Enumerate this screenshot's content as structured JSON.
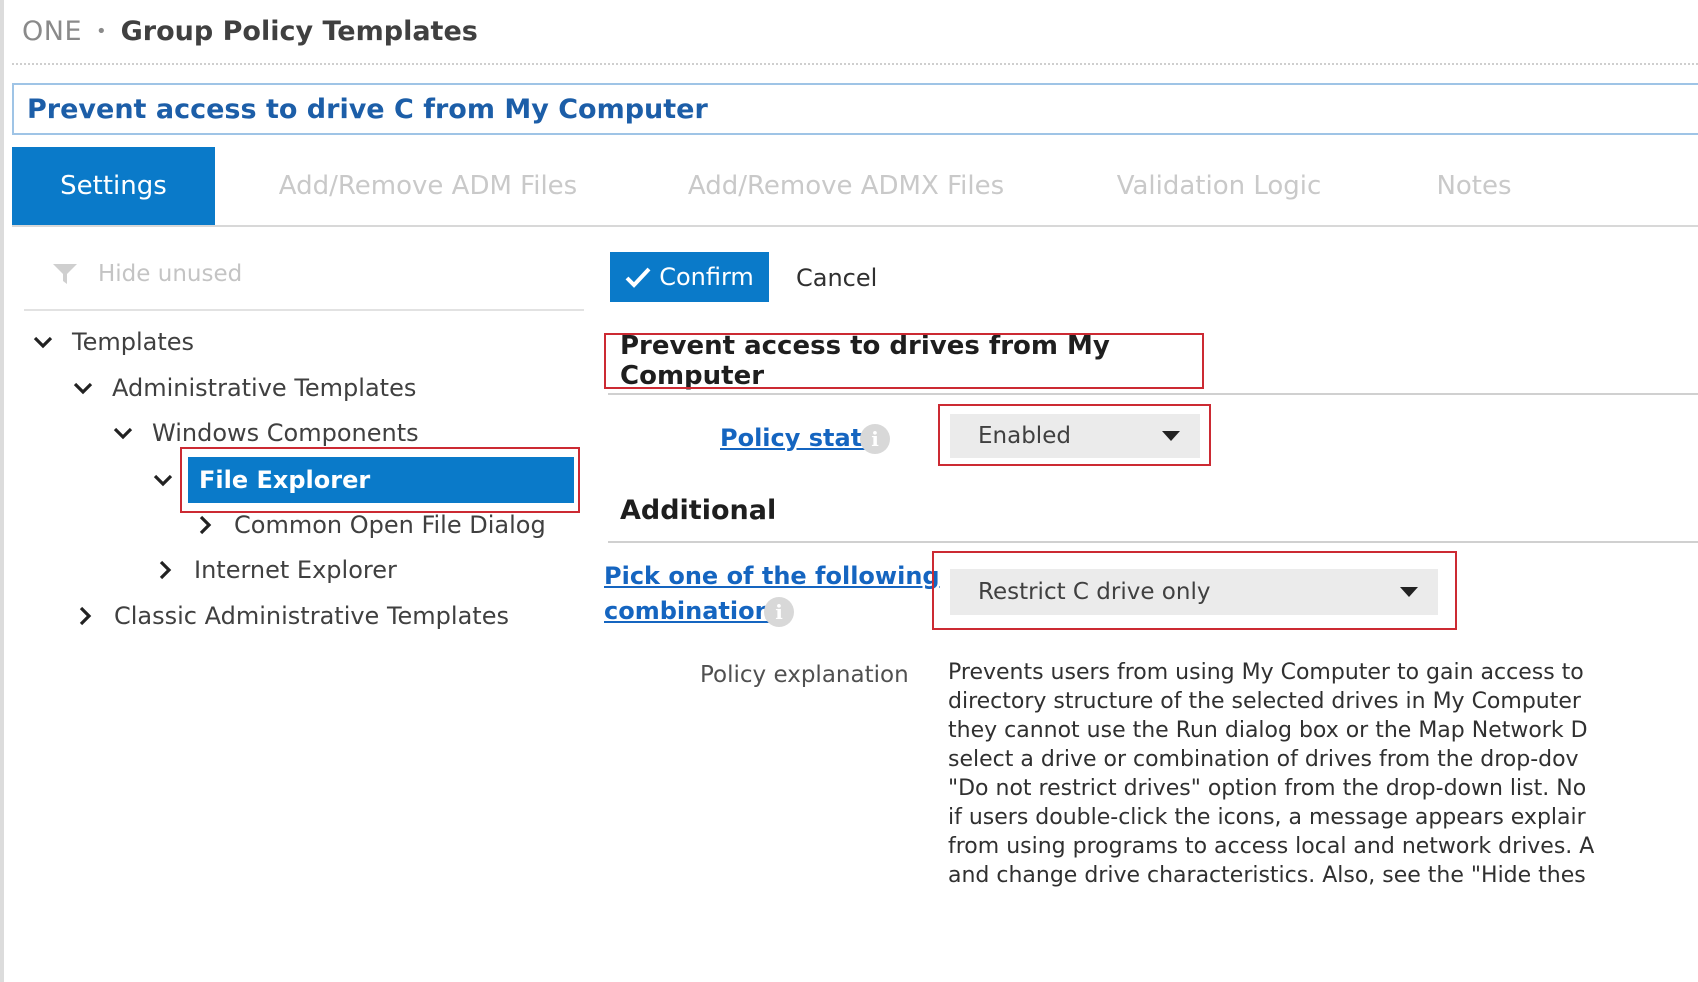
{
  "breadcrumb": {
    "root": "ONE",
    "separator": "•",
    "current": "Group Policy Templates"
  },
  "title": "Prevent access to drive C from My Computer",
  "tabs": [
    {
      "label": "Settings",
      "active": true
    },
    {
      "label": "Add/Remove ADM Files",
      "active": false
    },
    {
      "label": "Add/Remove ADMX Files",
      "active": false
    },
    {
      "label": "Validation Logic",
      "active": false
    },
    {
      "label": "Notes",
      "active": false
    }
  ],
  "filter": {
    "label": "Hide unused",
    "icon": "filter-icon"
  },
  "tree": {
    "templates": "Templates",
    "administrative_templates": "Administrative Templates",
    "windows_components": "Windows Components",
    "file_explorer": "File Explorer",
    "common_open_file_dialog": "Common Open File Dialog",
    "internet_explorer": "Internet Explorer",
    "classic_administrative_templates": "Classic Administrative Templates"
  },
  "actions": {
    "confirm": "Confirm",
    "cancel": "Cancel"
  },
  "policy": {
    "title": "Prevent access to drives from My Computer",
    "state_label": "Policy state",
    "state_value": "Enabled",
    "additional_heading": "Additional",
    "combination_label_line1": "Pick one of the following",
    "combination_label_line2": "combinations",
    "combination_value": "Restrict C drive only",
    "explanation_label": "Policy explanation",
    "explanation_lines": [
      "Prevents users from using My Computer to gain access to",
      "directory structure of the selected drives in My Computer",
      "they cannot use the Run dialog box or the Map Network D",
      "select a drive or combination of drives from the drop-dov",
      "\"Do not restrict drives\" option from the drop-down list. No",
      "if users double-click the icons, a message appears explair",
      "from using programs to access local and network drives. A",
      "and change drive characteristics. Also, see the \"Hide thes"
    ]
  },
  "colors": {
    "accent": "#0a7ac9",
    "link": "#1565c0",
    "highlight_border": "#cc2a33",
    "inactive_tab_text": "#c9c9c9"
  }
}
